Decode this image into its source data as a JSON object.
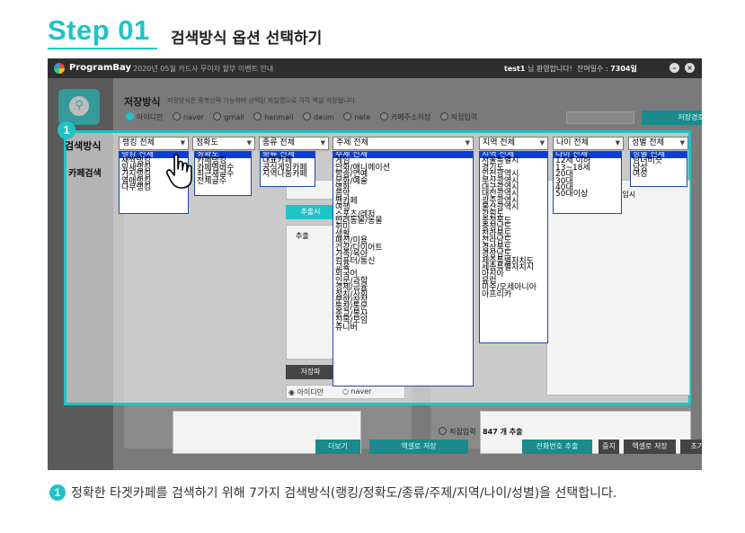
{
  "header": {
    "step": "Step 01",
    "title": "검색방식 옵션 선택하기"
  },
  "app": {
    "name": "ProgramBay",
    "notice": "2020년 05월 카드사 무이자 할부 이벤트 안내",
    "user_prefix": "test1",
    "user_suffix": "님 환영합니다!",
    "days_label": "잔여일수 :",
    "days_value": "7304일",
    "min_icon": "minimize-icon",
    "close_icon": "close-icon"
  },
  "save": {
    "label": "저장방식",
    "note": "저장방식은 중복선택 가능하며 선택된 파일명으로 각각 엑셀 저장됩니다.",
    "options": [
      "아이디만",
      "naver",
      "gmail",
      "hanmail",
      "daum",
      "nate",
      "카페주소저장",
      "직접입력"
    ],
    "path_button": "저장경로"
  },
  "side": {
    "search_method": "검색방식",
    "cafe_search": "카페검색"
  },
  "badge_number": "1",
  "dropdowns": [
    {
      "label": "랭킹 전체",
      "items": [
        "랭킹 전체",
        "새싹랭킹",
        "잎새랭킹",
        "가지랭킹",
        "열매랭킹",
        "나무랭킹"
      ]
    },
    {
      "label": "정확도",
      "items": [
        "정확도",
        "카페랭킹",
        "카페멤버수",
        "최근새글수",
        "전체글수"
      ]
    },
    {
      "label": "종류 전체",
      "items": [
        "종류 전체",
        "대표카페",
        "공식게임카페",
        "지역나눔카페"
      ]
    },
    {
      "label": "주제 전체",
      "items": [
        "주제 전체",
        "게임",
        "만화/애니메이션",
        "방송/연예",
        "문화/예술",
        "영화",
        "음악",
        "팬카페",
        "여행",
        "스포츠/레저",
        "반려동물/동물",
        "취미",
        "생활",
        "패션/미용",
        "건강/다이어트",
        "가족/육아",
        "컴퓨터/통신",
        "교육",
        "외국어",
        "인문/과학",
        "경제/금융",
        "정치/사회",
        "문학/창작",
        "동창/동문",
        "종교/봉사",
        "친목/모임",
        "쥬니버"
      ]
    },
    {
      "label": "지역 전체",
      "items": [
        "지역 전체",
        "서울특별시",
        "경기도",
        "인천광역시",
        "부산광역시",
        "대구광역시",
        "대전광역시",
        "광주광역시",
        "울산광역시",
        "강원도",
        "충청북도",
        "충청남도",
        "전라북도",
        "전라남도",
        "경상북도",
        "경상남도",
        "제주특별자치도",
        "세종특별자치시",
        "아시아",
        "유럽",
        "미주/오세아니아",
        "아프리카"
      ]
    },
    {
      "label": "나이 전체",
      "items": [
        "나이 전체",
        "12세 이하",
        "13~18세",
        "20대",
        "30대",
        "40대",
        "50대이상"
      ]
    },
    {
      "label": "성별 전체",
      "items": [
        "성별 전체",
        "남녀비슷",
        "남성",
        "여성"
      ]
    }
  ],
  "buttons": {
    "more": "더보기",
    "excel_save": "엑셀로 저장",
    "phone_extract": "전화번호 추출",
    "stop": "중지",
    "excel_save2": "엑셀로 저장",
    "reset": "초기화",
    "save_pane": "저장파",
    "add": "추출시"
  },
  "misc": {
    "direct_input": "직접입력",
    "extract_count": "847 개 추출",
    "radio_id_only": "아이디만",
    "radio_naver": "naver",
    "col_header": "총임시",
    "extract_label": "추출"
  },
  "footnote": "정확한 타겟카페를 검색하기 위해 7가지 검색방식(랭킹/정확도/종류/주제/지역/나이/성별)을 선택합니다."
}
